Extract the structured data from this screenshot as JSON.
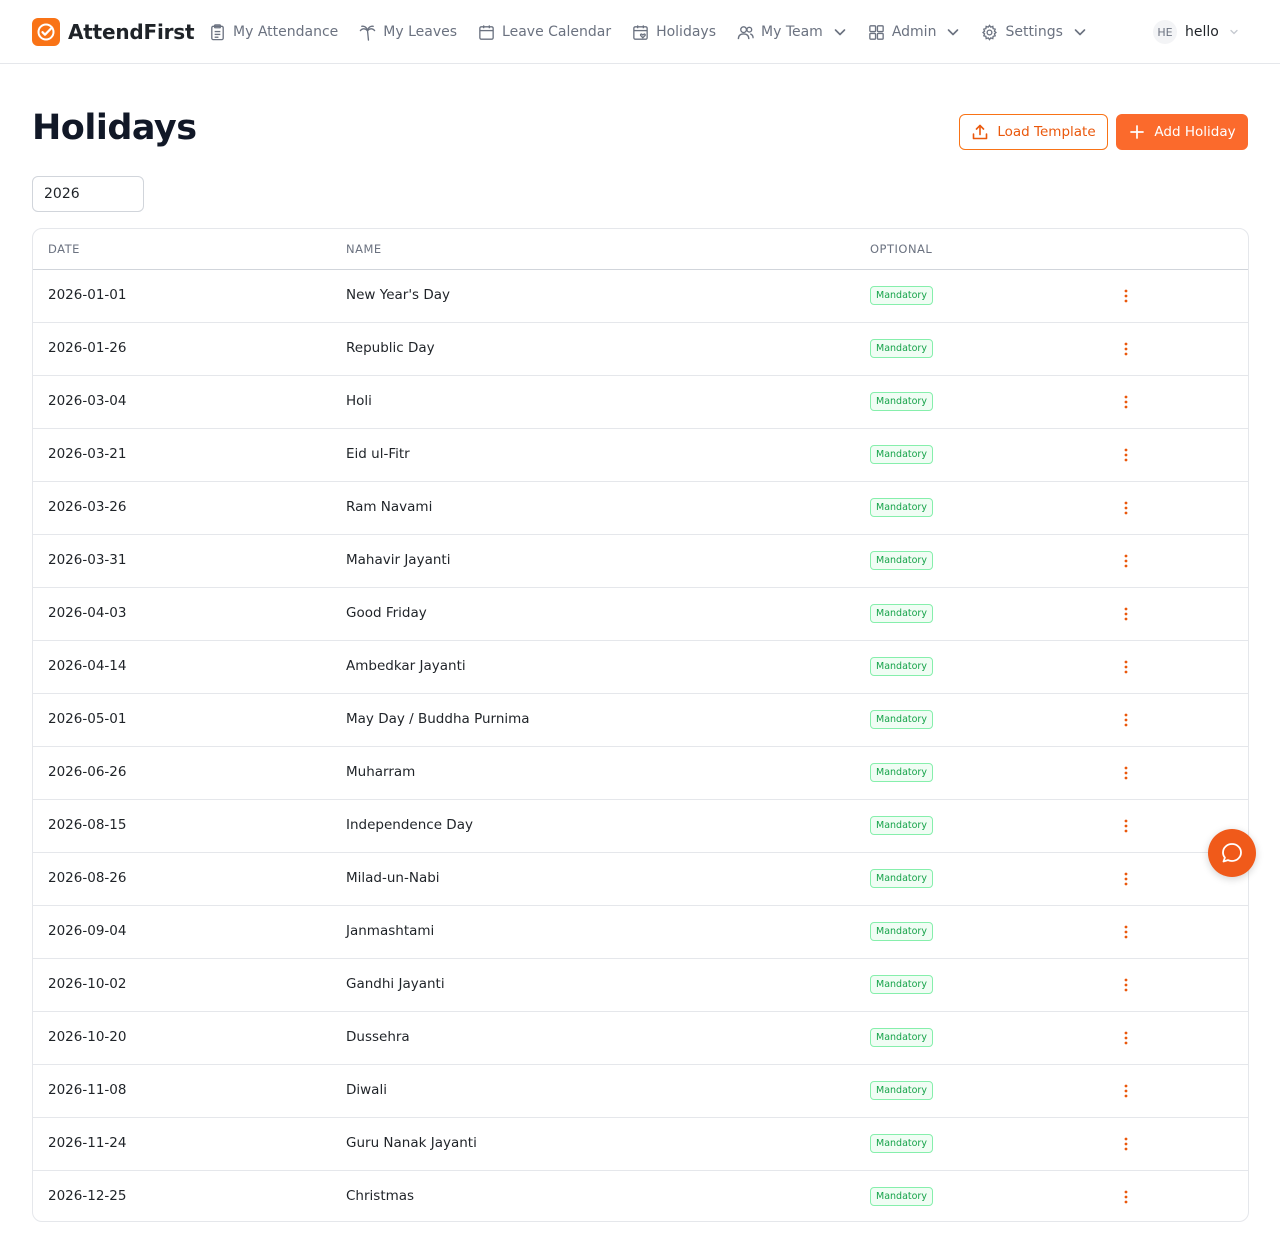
{
  "header": {
    "brand_name": "AttendFirst",
    "nav": [
      {
        "label": "My Attendance",
        "icon": "clipboard-icon"
      },
      {
        "label": "My Leaves",
        "icon": "palm-tree-icon"
      },
      {
        "label": "Leave Calendar",
        "icon": "calendar-icon"
      },
      {
        "label": "Holidays",
        "icon": "calendar-heart-icon"
      },
      {
        "label": "My Team",
        "icon": "users-icon"
      },
      {
        "label": "Admin",
        "icon": "grid-icon"
      },
      {
        "label": "Settings",
        "icon": "gear-icon"
      }
    ],
    "user": {
      "initials": "HE",
      "name": "hello"
    }
  },
  "page": {
    "title": "Holidays",
    "load_template_label": "Load Template",
    "add_holiday_label": "Add Holiday",
    "year_value": "2026"
  },
  "table": {
    "headers": {
      "date": "DATE",
      "name": "NAME",
      "optional": "OPTIONAL"
    },
    "rows": [
      {
        "date": "2026-01-01",
        "name": "New Year's Day",
        "status": "Mandatory"
      },
      {
        "date": "2026-01-26",
        "name": "Republic Day",
        "status": "Mandatory"
      },
      {
        "date": "2026-03-04",
        "name": "Holi",
        "status": "Mandatory"
      },
      {
        "date": "2026-03-21",
        "name": "Eid ul-Fitr",
        "status": "Mandatory"
      },
      {
        "date": "2026-03-26",
        "name": "Ram Navami",
        "status": "Mandatory"
      },
      {
        "date": "2026-03-31",
        "name": "Mahavir Jayanti",
        "status": "Mandatory"
      },
      {
        "date": "2026-04-03",
        "name": "Good Friday",
        "status": "Mandatory"
      },
      {
        "date": "2026-04-14",
        "name": "Ambedkar Jayanti",
        "status": "Mandatory"
      },
      {
        "date": "2026-05-01",
        "name": "May Day / Buddha Purnima",
        "status": "Mandatory"
      },
      {
        "date": "2026-06-26",
        "name": "Muharram",
        "status": "Mandatory"
      },
      {
        "date": "2026-08-15",
        "name": "Independence Day",
        "status": "Mandatory"
      },
      {
        "date": "2026-08-26",
        "name": "Milad-un-Nabi",
        "status": "Mandatory"
      },
      {
        "date": "2026-09-04",
        "name": "Janmashtami",
        "status": "Mandatory"
      },
      {
        "date": "2026-10-02",
        "name": "Gandhi Jayanti",
        "status": "Mandatory"
      },
      {
        "date": "2026-10-20",
        "name": "Dussehra",
        "status": "Mandatory"
      },
      {
        "date": "2026-11-08",
        "name": "Diwali",
        "status": "Mandatory"
      },
      {
        "date": "2026-11-24",
        "name": "Guru Nanak Jayanti",
        "status": "Mandatory"
      },
      {
        "date": "2026-12-25",
        "name": "Christmas",
        "status": "Mandatory"
      }
    ]
  },
  "colors": {
    "accent": "#f97316",
    "accent_dark": "#ea580c",
    "mandatory_badge": "#16a34a"
  }
}
